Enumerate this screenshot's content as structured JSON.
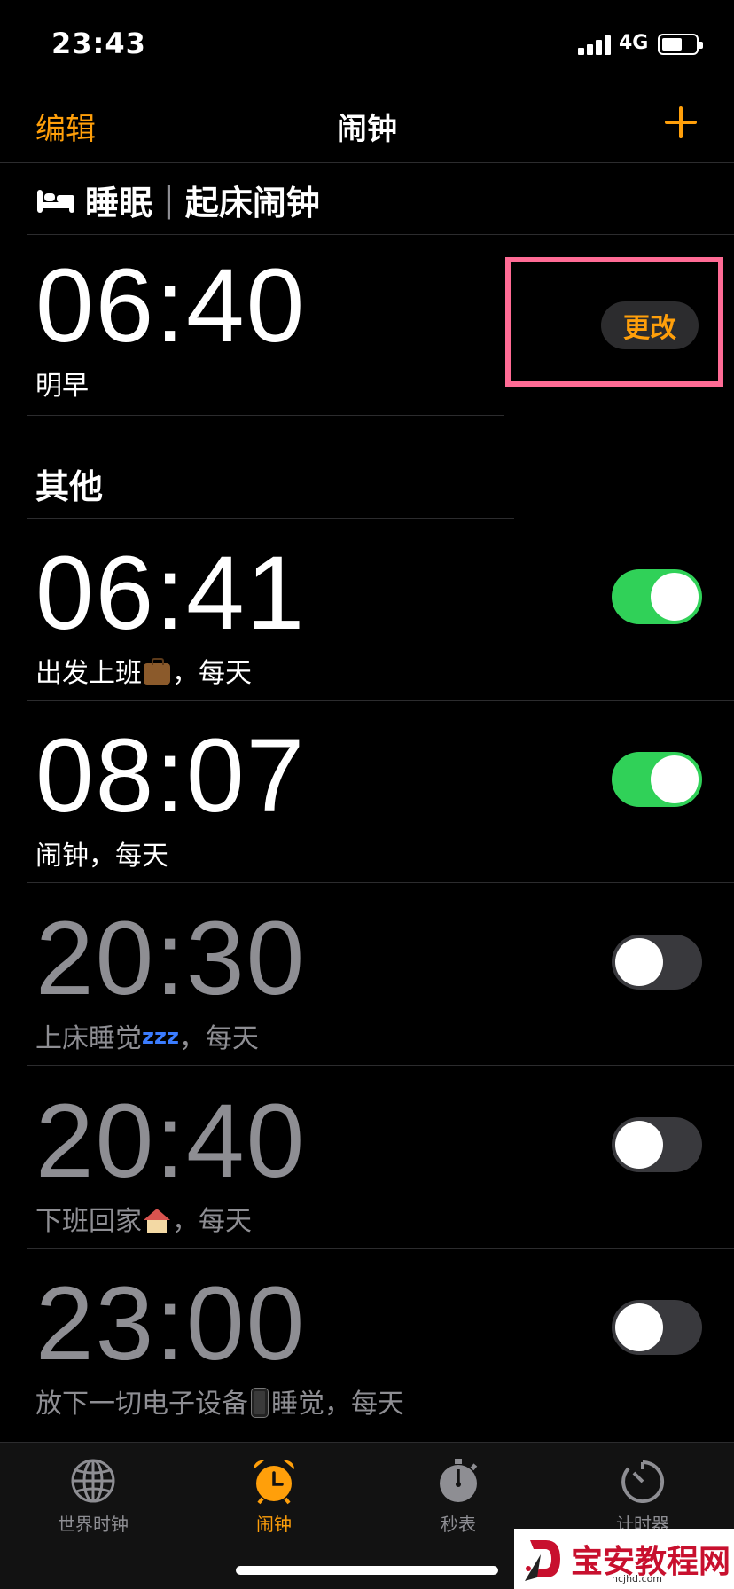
{
  "status_bar": {
    "time": "23:43",
    "network": "4G",
    "battery_level": 0.6
  },
  "nav": {
    "edit_label": "编辑",
    "title": "闹钟",
    "add_icon": "plus-icon"
  },
  "sleep": {
    "section_title": "睡眠",
    "section_subtitle": "起床闹钟",
    "icon": "bed-icon",
    "alarm": {
      "time": "06:40",
      "label": "明早"
    },
    "change_label": "更改"
  },
  "other": {
    "section_title": "其他",
    "alarms": [
      {
        "time": "06:41",
        "label_pre": "出发上班",
        "label_post": "，每天",
        "enabled": true
      },
      {
        "time": "08:07",
        "label_pre": "闹钟",
        "label_post": "，每天",
        "enabled": true
      },
      {
        "time": "20:30",
        "label_pre": "上床睡觉",
        "emoji_text": "zzz",
        "label_post": "，每天",
        "enabled": false
      },
      {
        "time": "20:40",
        "label_pre": "下班回家",
        "label_post": "，每天",
        "enabled": false
      },
      {
        "time": "23:00",
        "label_pre": "放下一切电子设备",
        "label_post": "睡觉，每天",
        "enabled": false
      }
    ]
  },
  "tabs": [
    {
      "label": "世界时钟",
      "icon": "globe-icon",
      "active": false
    },
    {
      "label": "闹钟",
      "icon": "alarm-clock-icon",
      "active": true
    },
    {
      "label": "秒表",
      "icon": "stopwatch-icon",
      "active": false
    },
    {
      "label": "计时器",
      "icon": "timer-icon",
      "active": false
    }
  ],
  "watermark": {
    "text": "宝安教程网",
    "url": "hcjhd.com"
  },
  "colors": {
    "accent": "#ff9f0a",
    "toggle_on": "#30d158",
    "highlight_box": "#ff6b95"
  }
}
